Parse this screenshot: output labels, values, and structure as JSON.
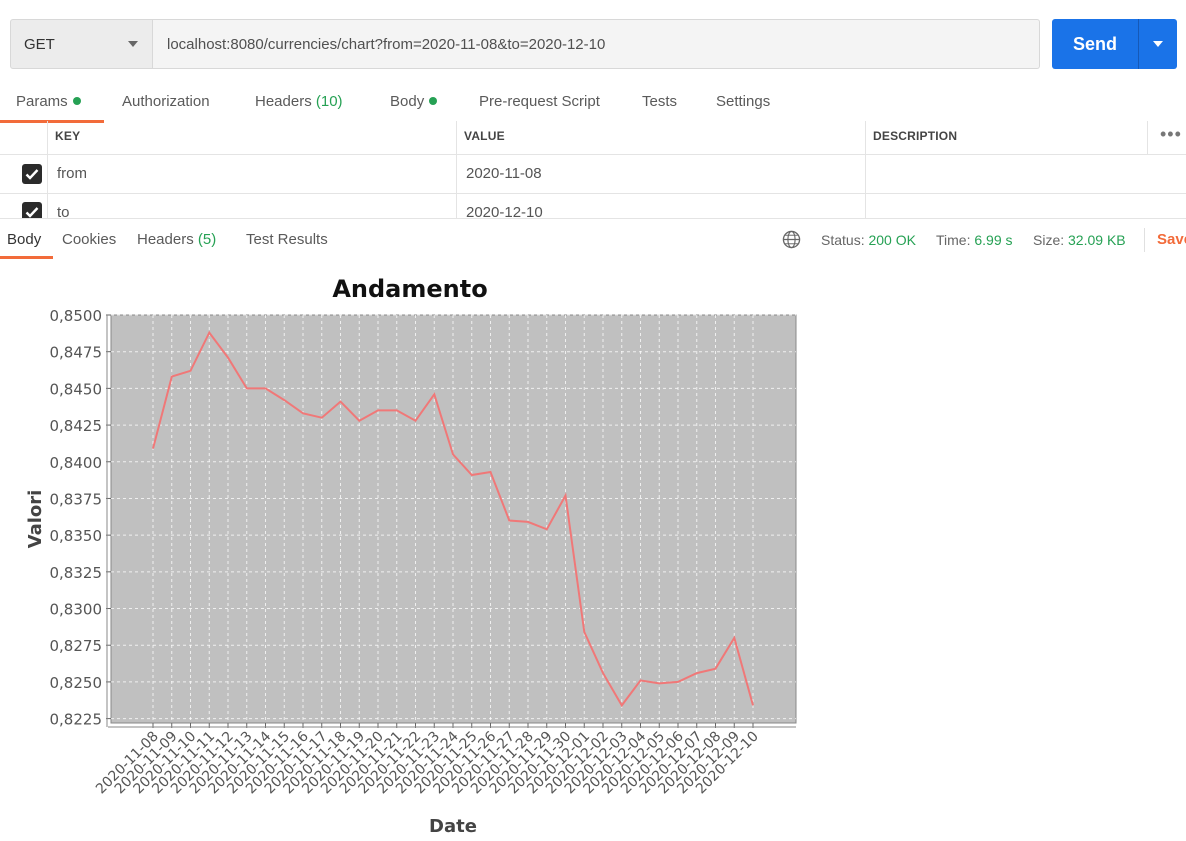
{
  "request": {
    "method": "GET",
    "url": "localhost:8080/currencies/chart?from=2020-11-08&to=2020-12-10",
    "send_label": "Send"
  },
  "request_tabs": {
    "params": "Params",
    "authorization": "Authorization",
    "headers": "Headers",
    "headers_count": "(10)",
    "body": "Body",
    "pre_request": "Pre-request Script",
    "tests": "Tests",
    "settings": "Settings"
  },
  "params_table": {
    "columns": [
      "KEY",
      "VALUE",
      "DESCRIPTION"
    ],
    "rows": [
      {
        "key": "from",
        "value": "2020-11-08",
        "checked": true
      },
      {
        "key": "to",
        "value": "2020-12-10",
        "checked": true
      }
    ]
  },
  "response_tabs": {
    "body": "Body",
    "cookies": "Cookies",
    "headers": "Headers",
    "headers_count": "(5)",
    "test_results": "Test Results"
  },
  "response_meta": {
    "status_label": "Status:",
    "status_value": "200 OK",
    "time_label": "Time:",
    "time_value": "6.99 s",
    "size_label": "Size:",
    "size_value": "32.09 KB",
    "save_label": "Save"
  },
  "colors": {
    "accent": "#f26b3a",
    "primary": "#1a73e8",
    "success": "#26a154",
    "plot_bg": "#c0c0c0",
    "series": "#f07878"
  },
  "chart_data": {
    "type": "line",
    "title": "Andamento",
    "xlabel": "Date",
    "ylabel": "Valori",
    "ylim": [
      0.8222,
      0.85
    ],
    "yticks": [
      0.8225,
      0.825,
      0.8275,
      0.83,
      0.8325,
      0.835,
      0.8375,
      0.84,
      0.8425,
      0.845,
      0.8475,
      0.85
    ],
    "ytick_labels": [
      "0,8225",
      "0,8250",
      "0,8275",
      "0,8300",
      "0,8325",
      "0,8350",
      "0,8375",
      "0,8400",
      "0,8425",
      "0,8450",
      "0,8475",
      "0,8500"
    ],
    "grid": true,
    "legend": "none",
    "x": [
      "2020-11-08",
      "2020-11-09",
      "2020-11-10",
      "2020-11-11",
      "2020-11-12",
      "2020-11-13",
      "2020-11-14",
      "2020-11-15",
      "2020-11-16",
      "2020-11-17",
      "2020-11-18",
      "2020-11-19",
      "2020-11-20",
      "2020-11-21",
      "2020-11-22",
      "2020-11-23",
      "2020-11-24",
      "2020-11-25",
      "2020-11-26",
      "2020-11-27",
      "2020-11-28",
      "2020-11-29",
      "2020-11-30",
      "2020-12-01",
      "2020-12-02",
      "2020-12-03",
      "2020-12-04",
      "2020-12-05",
      "2020-12-06",
      "2020-12-07",
      "2020-12-08",
      "2020-12-09",
      "2020-12-10"
    ],
    "series": [
      {
        "values": [
          0.8409,
          0.8458,
          0.8462,
          0.8488,
          0.8471,
          0.845,
          0.845,
          0.8442,
          0.8433,
          0.843,
          0.8441,
          0.8428,
          0.8435,
          0.8435,
          0.8428,
          0.8446,
          0.8405,
          0.8391,
          0.8393,
          0.836,
          0.8359,
          0.8354,
          0.8377,
          0.8284,
          0.8256,
          0.8234,
          0.8251,
          0.8249,
          0.825,
          0.8256,
          0.8259,
          0.828,
          0.8234
        ]
      }
    ]
  }
}
